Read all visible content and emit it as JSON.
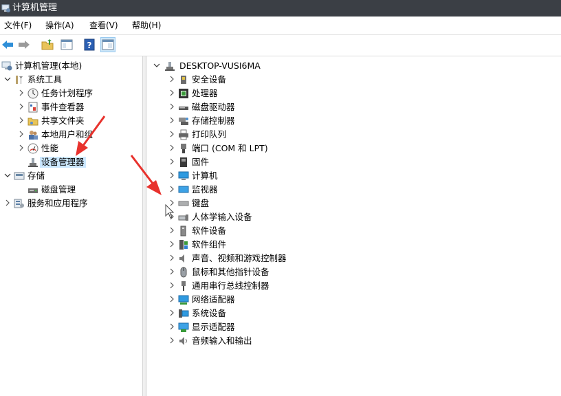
{
  "window": {
    "title": "计算机管理"
  },
  "menu": [
    "文件(F)",
    "操作(A)",
    "查看(V)",
    "帮助(H)"
  ],
  "toolbar": {
    "buttons": [
      "back-icon",
      "forward-icon",
      "up-folder-icon",
      "properties-icon",
      "help-icon",
      "show-hide-pane-icon"
    ]
  },
  "left_tree": {
    "root": "计算机管理(本地)",
    "items": [
      {
        "label": "系统工具",
        "expanded": true
      },
      {
        "label": "任务计划程序"
      },
      {
        "label": "事件查看器"
      },
      {
        "label": "共享文件夹"
      },
      {
        "label": "本地用户和组"
      },
      {
        "label": "性能"
      },
      {
        "label": "设备管理器",
        "selected": true
      },
      {
        "label": "存储",
        "expanded": true
      },
      {
        "label": "磁盘管理"
      },
      {
        "label": "服务和应用程序"
      }
    ]
  },
  "device_tree": {
    "root": "DESKTOP-VUSI6MA",
    "categories": [
      "安全设备",
      "处理器",
      "磁盘驱动器",
      "存储控制器",
      "打印队列",
      "端口 (COM 和 LPT)",
      "固件",
      "计算机",
      "监视器",
      "键盘",
      "人体学输入设备",
      "软件设备",
      "软件组件",
      "声音、视频和游戏控制器",
      "鼠标和其他指针设备",
      "通用串行总线控制器",
      "网络适配器",
      "系统设备",
      "显示适配器",
      "音频输入和输出"
    ]
  },
  "colors": {
    "titlebar": "#3b3f45",
    "selection": "#cce8ff",
    "annotation_arrow": "#e8322d"
  }
}
